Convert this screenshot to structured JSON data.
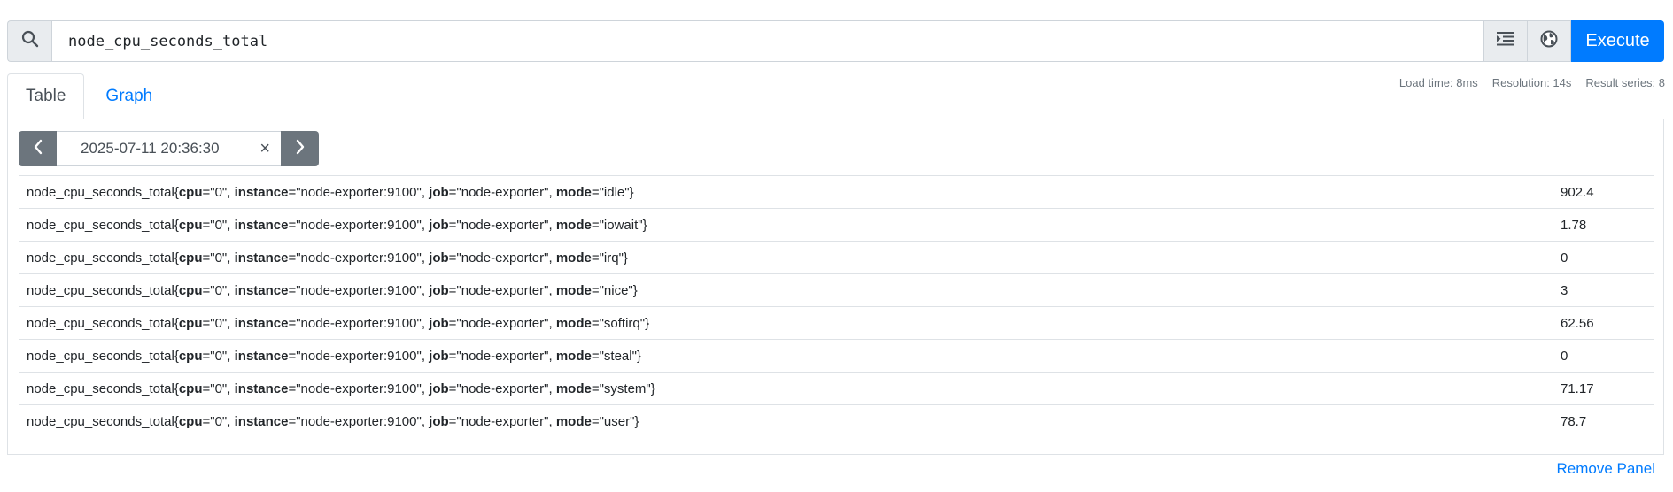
{
  "query": {
    "value": "node_cpu_seconds_total",
    "execute_label": "Execute"
  },
  "tabs": [
    {
      "label": "Table",
      "active": true
    },
    {
      "label": "Graph",
      "active": false
    }
  ],
  "stats": {
    "load_time": "Load time: 8ms",
    "resolution": "Resolution: 14s",
    "result_series": "Result series: 8"
  },
  "time": {
    "value": "2025-07-11 20:36:30",
    "clear_glyph": "×"
  },
  "results": [
    {
      "metric_name": "node_cpu_seconds_total",
      "labels": [
        {
          "k": "cpu",
          "v": "\"0\""
        },
        {
          "k": "instance",
          "v": "\"node-exporter:9100\""
        },
        {
          "k": "job",
          "v": "\"node-exporter\""
        },
        {
          "k": "mode",
          "v": "\"idle\""
        }
      ],
      "value": "902.4"
    },
    {
      "metric_name": "node_cpu_seconds_total",
      "labels": [
        {
          "k": "cpu",
          "v": "\"0\""
        },
        {
          "k": "instance",
          "v": "\"node-exporter:9100\""
        },
        {
          "k": "job",
          "v": "\"node-exporter\""
        },
        {
          "k": "mode",
          "v": "\"iowait\""
        }
      ],
      "value": "1.78"
    },
    {
      "metric_name": "node_cpu_seconds_total",
      "labels": [
        {
          "k": "cpu",
          "v": "\"0\""
        },
        {
          "k": "instance",
          "v": "\"node-exporter:9100\""
        },
        {
          "k": "job",
          "v": "\"node-exporter\""
        },
        {
          "k": "mode",
          "v": "\"irq\""
        }
      ],
      "value": "0"
    },
    {
      "metric_name": "node_cpu_seconds_total",
      "labels": [
        {
          "k": "cpu",
          "v": "\"0\""
        },
        {
          "k": "instance",
          "v": "\"node-exporter:9100\""
        },
        {
          "k": "job",
          "v": "\"node-exporter\""
        },
        {
          "k": "mode",
          "v": "\"nice\""
        }
      ],
      "value": "3"
    },
    {
      "metric_name": "node_cpu_seconds_total",
      "labels": [
        {
          "k": "cpu",
          "v": "\"0\""
        },
        {
          "k": "instance",
          "v": "\"node-exporter:9100\""
        },
        {
          "k": "job",
          "v": "\"node-exporter\""
        },
        {
          "k": "mode",
          "v": "\"softirq\""
        }
      ],
      "value": "62.56"
    },
    {
      "metric_name": "node_cpu_seconds_total",
      "labels": [
        {
          "k": "cpu",
          "v": "\"0\""
        },
        {
          "k": "instance",
          "v": "\"node-exporter:9100\""
        },
        {
          "k": "job",
          "v": "\"node-exporter\""
        },
        {
          "k": "mode",
          "v": "\"steal\""
        }
      ],
      "value": "0"
    },
    {
      "metric_name": "node_cpu_seconds_total",
      "labels": [
        {
          "k": "cpu",
          "v": "\"0\""
        },
        {
          "k": "instance",
          "v": "\"node-exporter:9100\""
        },
        {
          "k": "job",
          "v": "\"node-exporter\""
        },
        {
          "k": "mode",
          "v": "\"system\""
        }
      ],
      "value": "71.17"
    },
    {
      "metric_name": "node_cpu_seconds_total",
      "labels": [
        {
          "k": "cpu",
          "v": "\"0\""
        },
        {
          "k": "instance",
          "v": "\"node-exporter:9100\""
        },
        {
          "k": "job",
          "v": "\"node-exporter\""
        },
        {
          "k": "mode",
          "v": "\"user\""
        }
      ],
      "value": "78.7"
    }
  ],
  "footer": {
    "remove_panel_label": "Remove Panel"
  },
  "icons": {
    "search": "search-icon",
    "format": "indent-format-icon",
    "metrics_explorer": "globe-icon",
    "prev": "chevron-left-icon",
    "next": "chevron-right-icon",
    "clear": "close-icon"
  },
  "colors": {
    "accent": "#007bff",
    "secondary_button": "#6c757d",
    "addon_bg": "#e9ecef"
  }
}
